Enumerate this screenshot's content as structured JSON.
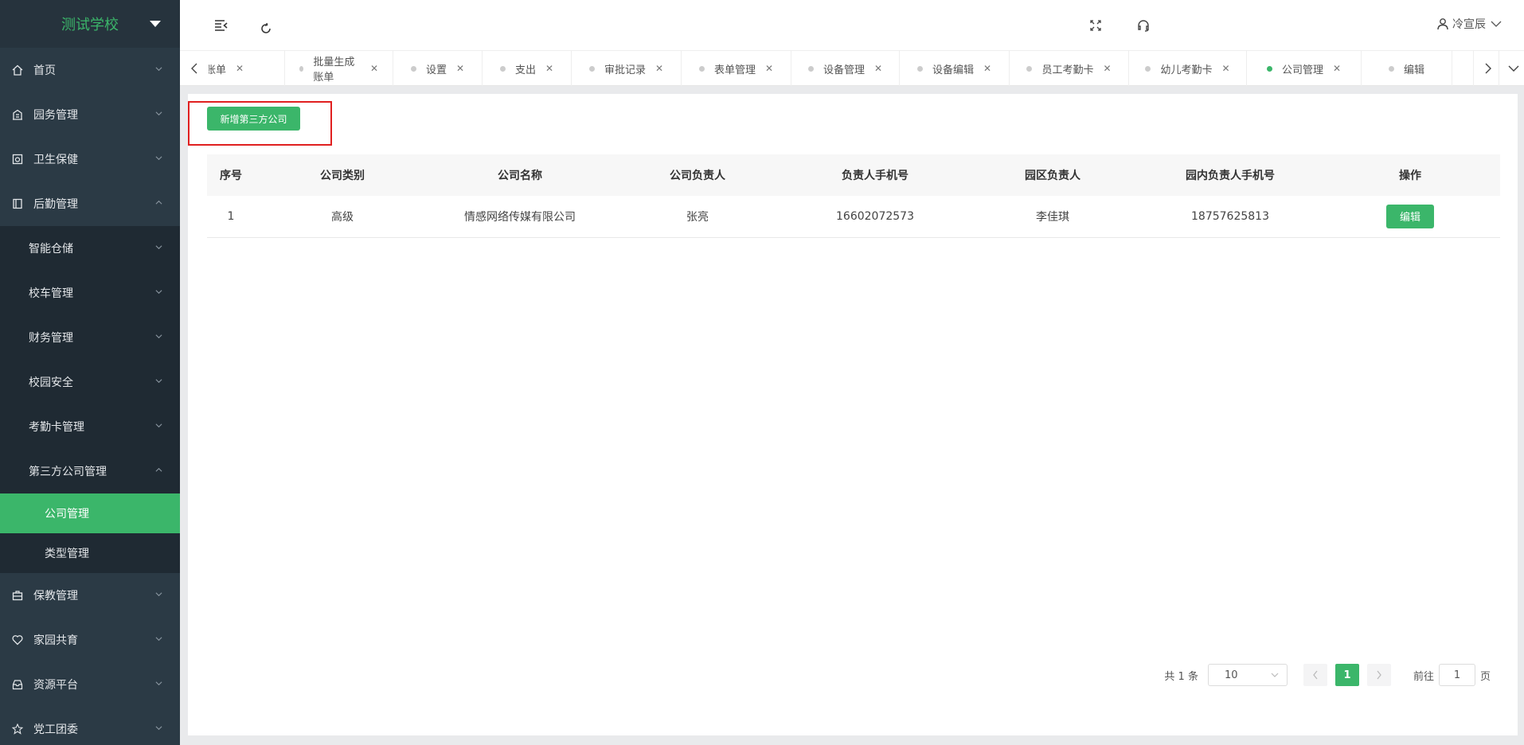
{
  "sidebar": {
    "logo": "测试学校",
    "items": [
      {
        "label": "首页"
      },
      {
        "label": "园务管理"
      },
      {
        "label": "卫生保健"
      },
      {
        "label": "后勤管理"
      }
    ],
    "sub": [
      {
        "label": "智能仓储"
      },
      {
        "label": "校车管理"
      },
      {
        "label": "财务管理"
      },
      {
        "label": "校园安全"
      },
      {
        "label": "考勤卡管理"
      },
      {
        "label": "第三方公司管理"
      }
    ],
    "sub2": [
      {
        "label": "公司管理"
      },
      {
        "label": "类型管理"
      }
    ],
    "bottom": [
      {
        "label": "保教管理"
      },
      {
        "label": "家园共育"
      },
      {
        "label": "资源平台"
      },
      {
        "label": "党工团委"
      }
    ]
  },
  "header": {
    "user": "冷宣辰"
  },
  "tabs": [
    {
      "label": "账单"
    },
    {
      "label": "批量生成账单"
    },
    {
      "label": "设置"
    },
    {
      "label": "支出"
    },
    {
      "label": "审批记录"
    },
    {
      "label": "表单管理"
    },
    {
      "label": "设备管理"
    },
    {
      "label": "设备编辑"
    },
    {
      "label": "员工考勤卡"
    },
    {
      "label": "幼儿考勤卡"
    },
    {
      "label": "公司管理"
    },
    {
      "label": "编辑"
    }
  ],
  "toolbar": {
    "add_label": "新增第三方公司"
  },
  "table": {
    "headers": [
      "序号",
      "公司类别",
      "公司名称",
      "公司负责人",
      "负责人手机号",
      "园区负责人",
      "园内负责人手机号",
      "操作"
    ],
    "rows": [
      {
        "no": "1",
        "category": "高级",
        "name": "情感网络传媒有限公司",
        "manager": "张亮",
        "manager_phone": "16602072573",
        "park_manager": "李佳琪",
        "park_phone": "18757625813",
        "action": "编辑"
      }
    ]
  },
  "pager": {
    "total": "共 1 条",
    "page_size": "10",
    "current": "1",
    "goto_prefix": "前往",
    "goto_value": "1",
    "goto_suffix": "页"
  }
}
